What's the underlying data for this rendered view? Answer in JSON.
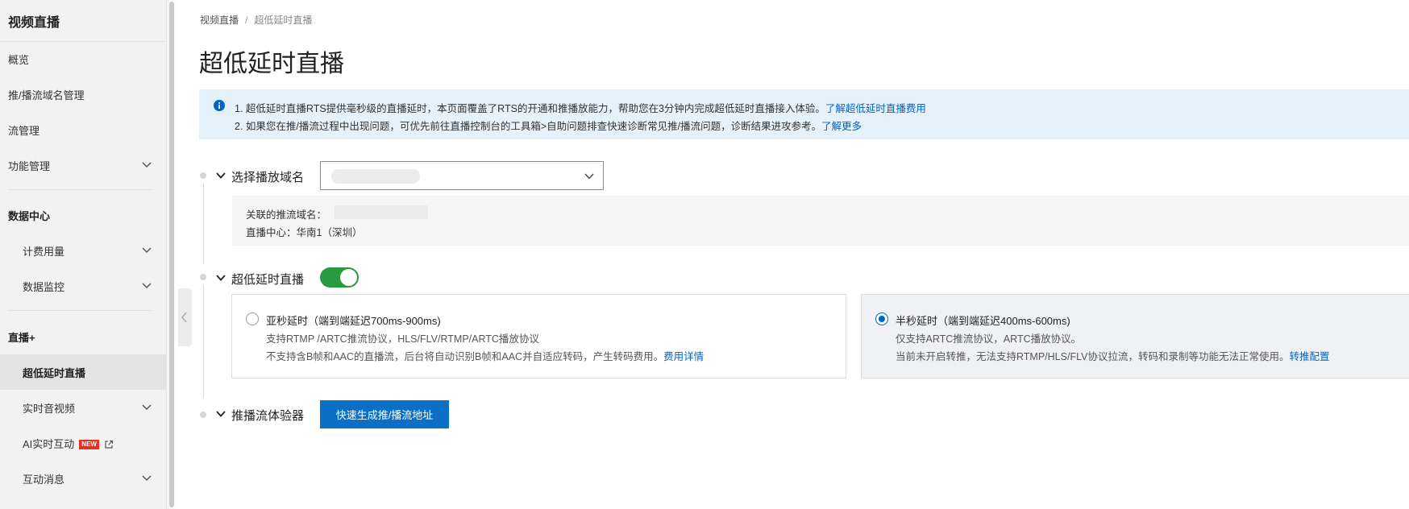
{
  "sidebar": {
    "title": "视频直播",
    "items": [
      {
        "label": "概览"
      },
      {
        "label": "推/播流域名管理"
      },
      {
        "label": "流管理"
      },
      {
        "label": "功能管理"
      },
      {
        "label": "数据中心"
      },
      {
        "label": "计费用量"
      },
      {
        "label": "数据监控"
      },
      {
        "label": "直播+"
      },
      {
        "label": "超低延时直播"
      },
      {
        "label": "实时音视频"
      },
      {
        "label": "AI实时互动",
        "badge": "NEW"
      },
      {
        "label": "互动消息"
      }
    ]
  },
  "breadcrumb": {
    "root": "视频直播",
    "separator": "/",
    "current": "超低延时直播"
  },
  "page_title": "超低延时直播",
  "notice": {
    "line1_text": "1. 超低延时直播RTS提供毫秒级的直播延时，本页面覆盖了RTS的开通和推播放能力，帮助您在3分钟内完成超低延时直播接入体验。",
    "line1_link": "了解超低延时直播费用",
    "line2_text": "2. 如果您在推/播流过程中出现问题，可优先前往直播控制台的工具箱>自助问题排查快速诊断常见推/播流问题，诊断结果进攻参考。",
    "line2_link": "了解更多"
  },
  "step1": {
    "title": "选择播放域名",
    "select_value": "",
    "push_domain_label": "关联的推流域名：",
    "center_label": "直播中心：",
    "center_value": "华南1（深圳）"
  },
  "step2": {
    "title": "超低延时直播",
    "toggle_on": true,
    "options": [
      {
        "title": "亚秒延时（端到端延迟700ms-900ms)",
        "desc1": "支持RTMP /ARTC推流协议，HLS/FLV/RTMP/ARTC播放协议",
        "desc2": "不支持含B帧和AAC的直播流，后台将自动识别B帧和AAC并自适应转码，产生转码费用。",
        "link": "费用详情",
        "selected": false
      },
      {
        "title": "半秒延时（端到端延迟400ms-600ms)",
        "desc1": "仅支持ARTC推流协议，ARTC播放协议。",
        "desc2": "当前未开启转推，无法支持RTMP/HLS/FLV协议拉流，转码和录制等功能无法正常使用。",
        "link": "转推配置",
        "selected": true
      }
    ]
  },
  "step3": {
    "title": "推播流体验器",
    "button": "快速生成推/播流地址"
  },
  "colors": {
    "accent": "#0064c8",
    "toggle_on": "#2a9a3e",
    "new_badge": "#e0321f",
    "notice_bg": "#e5f1fb"
  }
}
